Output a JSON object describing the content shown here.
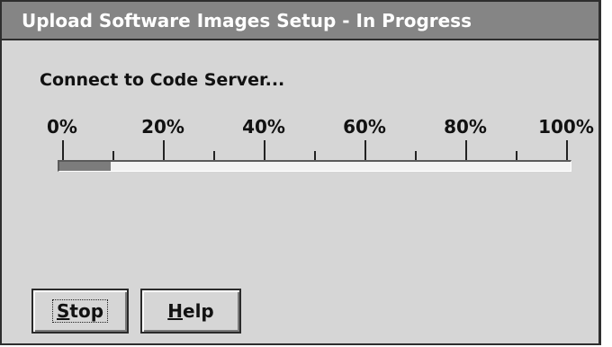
{
  "window": {
    "title": "Upload Software Images Setup - In Progress"
  },
  "status": {
    "message": "Connect to Code Server..."
  },
  "progress": {
    "scale_labels": [
      "0%",
      "20%",
      "40%",
      "60%",
      "80%",
      "100%"
    ],
    "percent": 10
  },
  "buttons": {
    "stop": {
      "mnemonic": "S",
      "rest": "top"
    },
    "help": {
      "mnemonic": "H",
      "rest": "elp"
    }
  }
}
